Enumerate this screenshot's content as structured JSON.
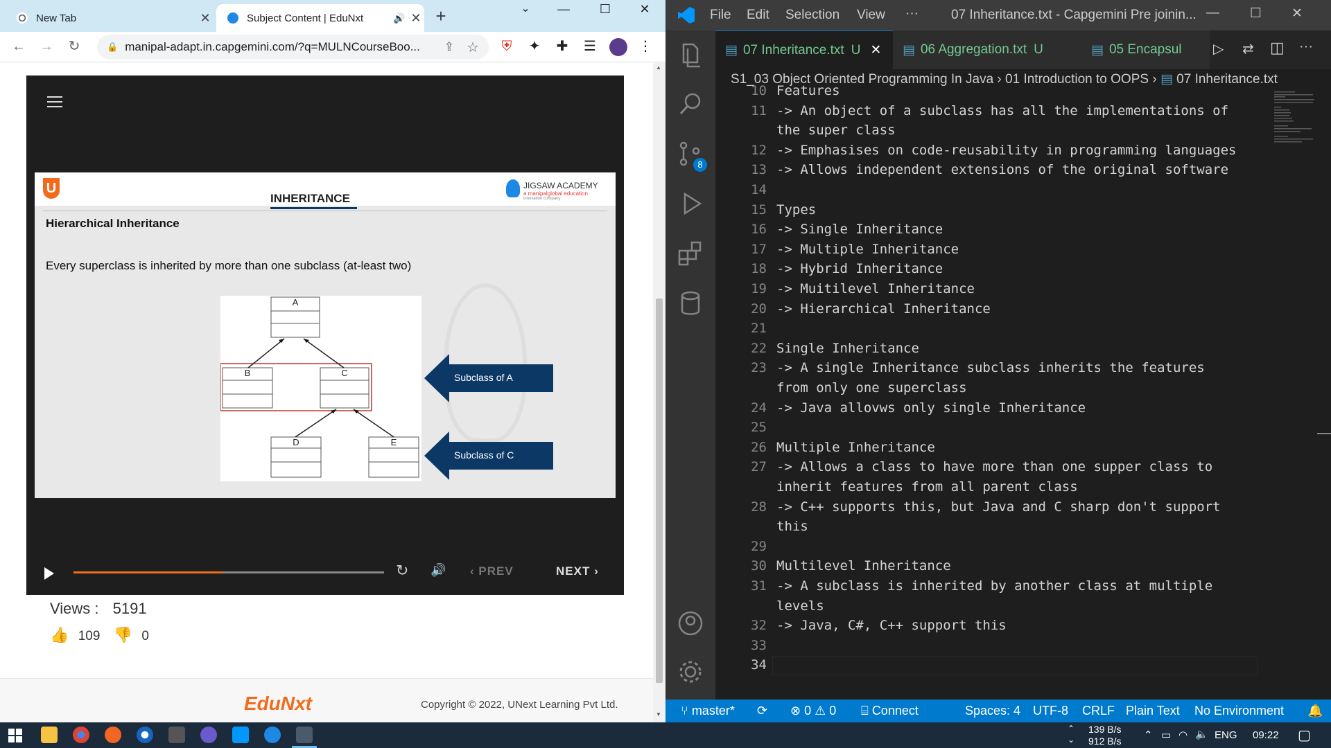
{
  "browser": {
    "tabs": [
      {
        "title": "New Tab"
      },
      {
        "title": "Subject Content | EduNxt"
      }
    ],
    "new_tab_symbol": "+",
    "url": "manipal-adapt.in.capgemini.com/?q=MULNCourseBoo...",
    "window_controls": {
      "minimize": "—",
      "maximize": "☐",
      "close": "✕",
      "chevron": "⌄"
    }
  },
  "player": {
    "slide": {
      "brand_letter": "U",
      "heading": "INHERITANCE",
      "academy": "JIGSAW ACADEMY",
      "academy_sub": "a manipalglobal education",
      "academy_sub2": "innovation company",
      "subtitle": "Hierarchical Inheritance",
      "description": "Every superclass is inherited by more than one subclass (at-least two)",
      "uml_boxes": [
        "A",
        "B",
        "C",
        "D",
        "E"
      ],
      "arrow1": "Subclass of A",
      "arrow2": "Subclass of C"
    },
    "controls": {
      "prev": "PREV",
      "next": "NEXT",
      "progress_fraction": 0.48
    }
  },
  "stats": {
    "views_label": "Views :",
    "views": "5191",
    "likes": "109",
    "dislikes": "0"
  },
  "footer": {
    "logo": "EduNxt",
    "copyright": "Copyright © 2022, UNext Learning Pvt Ltd."
  },
  "vscode": {
    "menu": [
      "File",
      "Edit",
      "Selection",
      "View",
      "···"
    ],
    "window_title": "07 Inheritance.txt - Capgemini Pre joinin...",
    "tabs": [
      {
        "name": "07 Inheritance.txt",
        "status": "U"
      },
      {
        "name": "06 Aggregation.txt",
        "status": "U"
      },
      {
        "name": "05 Encapsul",
        "status": ""
      }
    ],
    "breadcrumb": [
      "S1_03 Object Oriented Programming In Java",
      "01 Introduction to OOPS",
      "07 Inheritance.txt"
    ],
    "source_control_badge": "8",
    "lines": [
      {
        "n": "10",
        "t": "Features"
      },
      {
        "n": "11",
        "t": "-> An object of a subclass has all the implementations of"
      },
      {
        "n": "",
        "t": "the super class"
      },
      {
        "n": "12",
        "t": "-> Emphasises on code-reusability in programming languages"
      },
      {
        "n": "13",
        "t": "-> Allows independent extensions of the original software"
      },
      {
        "n": "14",
        "t": ""
      },
      {
        "n": "15",
        "t": "Types"
      },
      {
        "n": "16",
        "t": "-> Single Inheritance"
      },
      {
        "n": "17",
        "t": "-> Multiple Inheritance"
      },
      {
        "n": "18",
        "t": "-> Hybrid Inheritance"
      },
      {
        "n": "19",
        "t": "-> Muitilevel Inheritance"
      },
      {
        "n": "20",
        "t": "-> Hierarchical Inheritance"
      },
      {
        "n": "21",
        "t": ""
      },
      {
        "n": "22",
        "t": "Single Inheritance"
      },
      {
        "n": "23",
        "t": "-> A single Inheritance subclass inherits the features"
      },
      {
        "n": "",
        "t": "from only one superclass"
      },
      {
        "n": "24",
        "t": "-> Java allovws only single Inheritance"
      },
      {
        "n": "25",
        "t": ""
      },
      {
        "n": "26",
        "t": "Multiple Inheritance"
      },
      {
        "n": "27",
        "t": "-> Allows a class to have more than one supper class to"
      },
      {
        "n": "",
        "t": "inherit features from all parent class"
      },
      {
        "n": "28",
        "t": "-> C++ supports this, but Java and C sharp don't support"
      },
      {
        "n": "",
        "t": "this"
      },
      {
        "n": "29",
        "t": ""
      },
      {
        "n": "30",
        "t": "Multilevel Inheritance"
      },
      {
        "n": "31",
        "t": "-> A subclass is inherited by another class at multiple"
      },
      {
        "n": "",
        "t": "levels"
      },
      {
        "n": "32",
        "t": "-> Java, C#, C++ support this"
      },
      {
        "n": "33",
        "t": ""
      },
      {
        "n": "34",
        "t": ""
      }
    ],
    "status": {
      "branch": "master*",
      "errors": "0",
      "warnings": "0",
      "connect": "Connect",
      "spaces": "Spaces: 4",
      "encoding": "UTF-8",
      "eol": "CRLF",
      "language": "Plain Text",
      "env": "No Environment"
    }
  },
  "taskbar": {
    "net_up": "139 B/s",
    "net_down": "912 B/s",
    "lang": "ENG",
    "time": "09:22"
  },
  "colors": {
    "vs_blue": "#007acc",
    "accent_orange": "#f26b1d",
    "arrow_navy": "#0c3866",
    "chrome_tabbar": "#cfe8f4"
  }
}
